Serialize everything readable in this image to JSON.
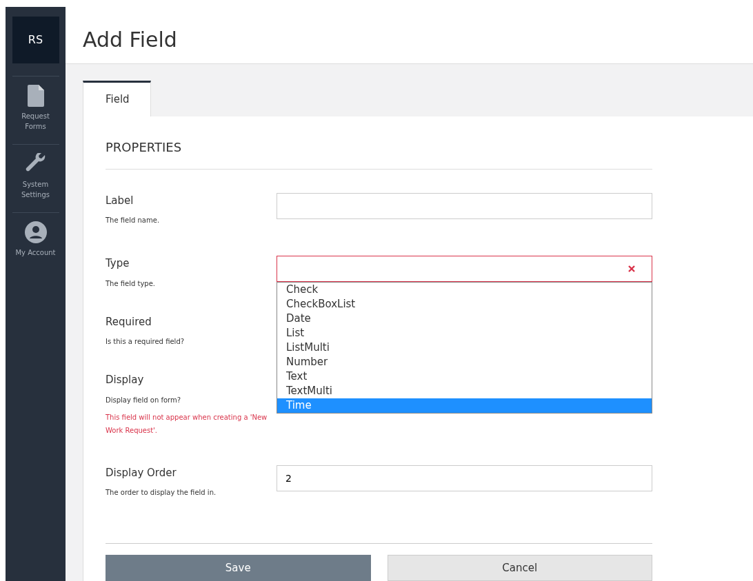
{
  "sidebar": {
    "avatar": "RS",
    "items": [
      {
        "label": "Request Forms"
      },
      {
        "label": "System Settings"
      },
      {
        "label": "My Account"
      }
    ]
  },
  "page_title": "Add Field",
  "tabs": [
    {
      "label": "Field",
      "selected": true
    }
  ],
  "section_title": "PROPERTIES",
  "fields": [
    {
      "kind": "text",
      "label": "Label",
      "help": "The field name."
    },
    {
      "kind": "select",
      "label": "Type",
      "help": "The field type.",
      "invalid": true,
      "expanded": true,
      "options": [
        {
          "label": "Check",
          "selected": false
        },
        {
          "label": "CheckBoxList",
          "selected": false
        },
        {
          "label": "Date",
          "selected": false
        },
        {
          "label": "List",
          "selected": false
        },
        {
          "label": "ListMulti",
          "selected": false
        },
        {
          "label": "Number",
          "selected": false
        },
        {
          "label": "Text",
          "selected": false
        },
        {
          "label": "TextMulti",
          "selected": false
        },
        {
          "label": "Time",
          "selected": true
        }
      ]
    },
    {
      "kind": "hidden",
      "label": "Required",
      "help": "Is this a required field?"
    },
    {
      "kind": "hidden",
      "label": "Display",
      "help": "Display field on form?",
      "warning": "This field will not appear when creating a 'New Work Request'."
    },
    {
      "kind": "text",
      "label": "Display Order",
      "help": "The order to display the field in.",
      "value": "2"
    }
  ],
  "buttons": [
    {
      "kind": "primary",
      "label": "Save"
    },
    {
      "kind": "secondary",
      "label": "Cancel"
    }
  ]
}
